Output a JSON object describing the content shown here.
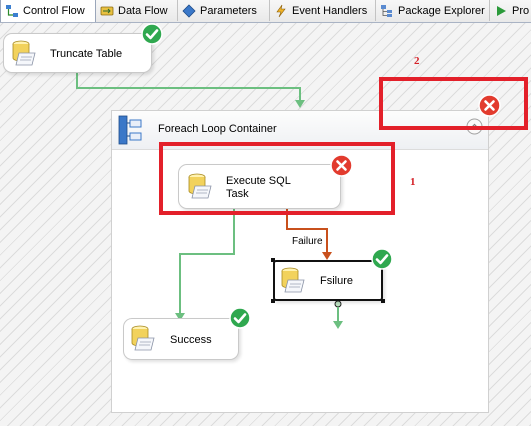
{
  "tabs": [
    {
      "label": "Control Flow",
      "active": true
    },
    {
      "label": "Data Flow",
      "active": false
    },
    {
      "label": "Parameters",
      "active": false
    },
    {
      "label": "Event Handlers",
      "active": false
    },
    {
      "label": "Package Explorer",
      "active": false
    },
    {
      "label": "Pro",
      "active": false
    }
  ],
  "canvas": {
    "truncate_task": {
      "label": "Truncate Table",
      "status": "success"
    },
    "foreach_container": {
      "label": "Foreach Loop Container",
      "status": "error"
    },
    "execute_sql_task": {
      "label_line1": "Execute SQL",
      "label_line2": "Task",
      "status": "error"
    },
    "failure_task": {
      "label": "Fsilure",
      "status": "success"
    },
    "success_task": {
      "label": "Success",
      "status": "success"
    },
    "failure_constraint_label": "Failure"
  },
  "annotations": {
    "marker_1": "1",
    "marker_2": "2"
  },
  "colors": {
    "success_green": "#2fa84f",
    "error_red": "#e23b2e",
    "annotation_red": "#e3202a",
    "success_arrow": "#6cbf80",
    "failure_arrow": "#c8501c"
  }
}
